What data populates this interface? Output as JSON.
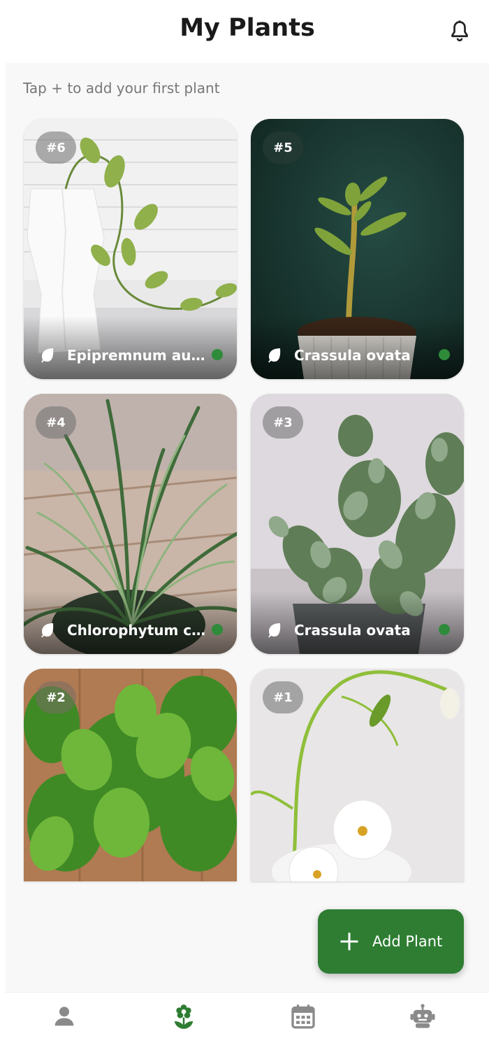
{
  "header": {
    "title": "My Plants"
  },
  "hint": "Tap + to add your first plant",
  "plants": [
    {
      "badge": "#6",
      "name": "Epipremnum aur...",
      "healthy": true
    },
    {
      "badge": "#5",
      "name": "Crassula ovata",
      "healthy": true
    },
    {
      "badge": "#4",
      "name": "Chlorophytum co...",
      "healthy": true
    },
    {
      "badge": "#3",
      "name": "Crassula ovata",
      "healthy": true
    },
    {
      "badge": "#2"
    },
    {
      "badge": "#1"
    }
  ],
  "fab": {
    "label": "Add Plant",
    "icon": "plus-icon"
  },
  "nav": {
    "items": [
      {
        "icon": "person-icon",
        "active": false
      },
      {
        "icon": "flower-icon",
        "active": true
      },
      {
        "icon": "calendar-icon",
        "active": false
      },
      {
        "icon": "robot-icon",
        "active": false
      }
    ]
  },
  "colors": {
    "accent": "#2e7d32",
    "status_ok": "#2e8b3a",
    "nav_inactive": "#8a8a8a"
  }
}
